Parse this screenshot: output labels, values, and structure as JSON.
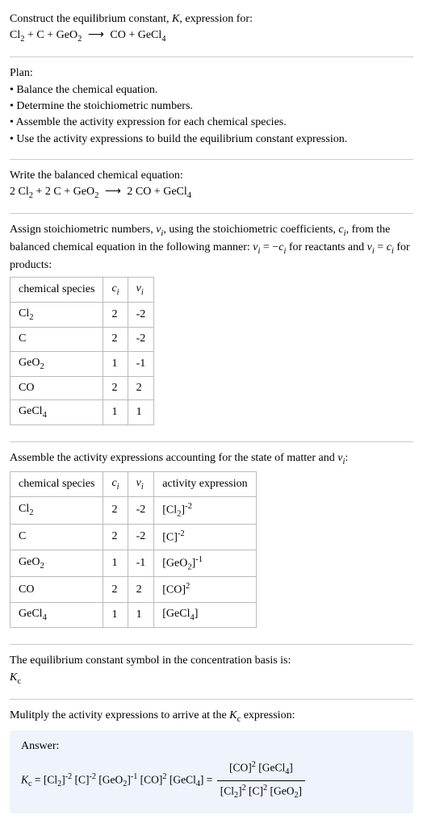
{
  "intro": {
    "line1": "Construct the equilibrium constant, K, expression for:",
    "eq": "Cl₂ + C + GeO₂ ⟶ CO + GeCl₄"
  },
  "plan": {
    "heading": "Plan:",
    "items": [
      "Balance the chemical equation.",
      "Determine the stoichiometric numbers.",
      "Assemble the activity expression for each chemical species.",
      "Use the activity expressions to build the equilibrium constant expression."
    ]
  },
  "balanced": {
    "heading": "Write the balanced chemical equation:",
    "eq": "2 Cl₂ + 2 C + GeO₂ ⟶ 2 CO + GeCl₄"
  },
  "stoich": {
    "text1": "Assign stoichiometric numbers, νᵢ, using the stoichiometric coefficients, cᵢ, from the balanced chemical equation in the following manner: νᵢ = −cᵢ for reactants and νᵢ = cᵢ for products:",
    "headers": [
      "chemical species",
      "cᵢ",
      "νᵢ"
    ],
    "rows": [
      {
        "sp": "Cl₂",
        "c": "2",
        "v": "-2"
      },
      {
        "sp": "C",
        "c": "2",
        "v": "-2"
      },
      {
        "sp": "GeO₂",
        "c": "1",
        "v": "-1"
      },
      {
        "sp": "CO",
        "c": "2",
        "v": "2"
      },
      {
        "sp": "GeCl₄",
        "c": "1",
        "v": "1"
      }
    ]
  },
  "activity": {
    "text1": "Assemble the activity expressions accounting for the state of matter and νᵢ:",
    "headers": [
      "chemical species",
      "cᵢ",
      "νᵢ",
      "activity expression"
    ],
    "rows": [
      {
        "sp": "Cl₂",
        "c": "2",
        "v": "-2",
        "a": "[Cl₂]⁻²"
      },
      {
        "sp": "C",
        "c": "2",
        "v": "-2",
        "a": "[C]⁻²"
      },
      {
        "sp": "GeO₂",
        "c": "1",
        "v": "-1",
        "a": "[GeO₂]⁻¹"
      },
      {
        "sp": "CO",
        "c": "2",
        "v": "2",
        "a": "[CO]²"
      },
      {
        "sp": "GeCl₄",
        "c": "1",
        "v": "1",
        "a": "[GeCl₄]"
      }
    ]
  },
  "basis": {
    "line1": "The equilibrium constant symbol in the concentration basis is:",
    "symbol": "K_c"
  },
  "final": {
    "line1": "Mulitply the activity expressions to arrive at the K_c expression:",
    "answer_label": "Answer:",
    "lhs": "K_c = [Cl₂]⁻² [C]⁻² [GeO₂]⁻¹ [CO]² [GeCl₄] =",
    "num": "[CO]² [GeCl₄]",
    "den": "[Cl₂]² [C]² [GeO₂]"
  },
  "chart_data": {
    "type": "table",
    "title": "Stoichiometric numbers and activity expressions",
    "tables": [
      {
        "columns": [
          "chemical species",
          "c_i",
          "ν_i"
        ],
        "rows": [
          [
            "Cl2",
            2,
            -2
          ],
          [
            "C",
            2,
            -2
          ],
          [
            "GeO2",
            1,
            -1
          ],
          [
            "CO",
            2,
            2
          ],
          [
            "GeCl4",
            1,
            1
          ]
        ]
      },
      {
        "columns": [
          "chemical species",
          "c_i",
          "ν_i",
          "activity expression"
        ],
        "rows": [
          [
            "Cl2",
            2,
            -2,
            "[Cl2]^-2"
          ],
          [
            "C",
            2,
            -2,
            "[C]^-2"
          ],
          [
            "GeO2",
            1,
            -1,
            "[GeO2]^-1"
          ],
          [
            "CO",
            2,
            2,
            "[CO]^2"
          ],
          [
            "GeCl4",
            1,
            1,
            "[GeCl4]"
          ]
        ]
      }
    ],
    "balanced_equation": "2 Cl2 + 2 C + GeO2 -> 2 CO + GeCl4",
    "Kc_expression": "[CO]^2 [GeCl4] / ([Cl2]^2 [C]^2 [GeO2])"
  }
}
